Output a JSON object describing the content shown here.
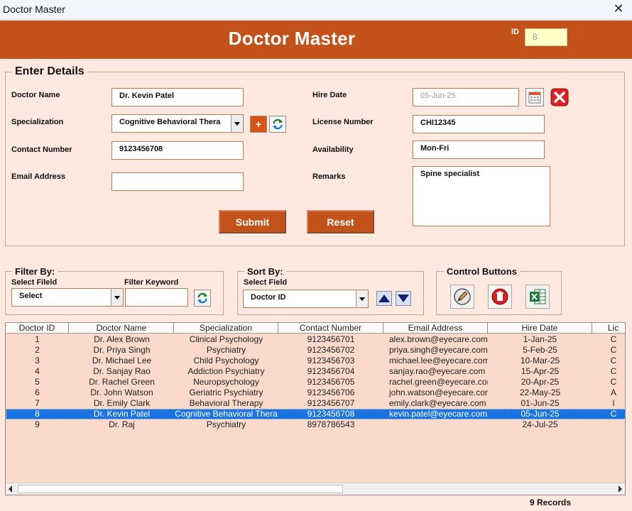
{
  "window": {
    "title": "Doctor Master",
    "close_glyph": "✕"
  },
  "header": {
    "title": "Doctor Master",
    "id_label": "ID",
    "id_value": "8"
  },
  "details": {
    "legend": "Enter Details",
    "doctor_name_label": "Doctor Name",
    "doctor_name_value": "Dr. Kevin Patel",
    "specialization_label": "Specialization",
    "specialization_value": "Cognitive Behavioral Thera",
    "contact_label": "Contact Number",
    "contact_value": "9123456708",
    "email_label": "Email Address",
    "email_value": "",
    "hire_date_label": "Hire Date",
    "hire_date_value": "05-Jun-25",
    "license_label": "License Number",
    "license_value": "CHI12345",
    "availability_label": "Availability",
    "availability_value": "Mon-Fri",
    "remarks_label": "Remarks",
    "remarks_value": "Spine specialist",
    "plus_glyph": "+",
    "submit_label": "Submit",
    "reset_label": "Reset"
  },
  "filter": {
    "legend": "Filter By:",
    "field_label": "Select Fileld",
    "field_value": "Select",
    "keyword_label": "Filter Keyword",
    "keyword_value": ""
  },
  "sort": {
    "legend": "Sort By:",
    "field_label": "Select Field",
    "field_value": "Doctor ID"
  },
  "control": {
    "legend": "Control Buttons"
  },
  "table": {
    "columns": [
      "Doctor ID",
      "Doctor Name",
      "Specialization",
      "Contact Number",
      "Email Address",
      "Hire Date",
      "Lic"
    ],
    "rows": [
      [
        "1",
        "Dr. Alex Brown",
        "Clinical Psychology",
        "9123456701",
        "alex.brown@eyecare.com",
        "1-Jan-25",
        "C"
      ],
      [
        "2",
        "Dr. Priya Singh",
        "Psychiatry",
        "9123456702",
        "priya.singh@eyecare.com",
        "5-Feb-25",
        "C"
      ],
      [
        "3",
        "Dr. Michael Lee",
        "Child Psychology",
        "9123456703",
        "michael.lee@eyecare.com",
        "10-Mar-25",
        "C"
      ],
      [
        "4",
        "Dr. Sanjay Rao",
        "Addiction Psychiatry",
        "9123456704",
        "sanjay.rao@eyecare.com",
        "15-Apr-25",
        "C"
      ],
      [
        "5",
        "Dr. Rachel Green",
        "Neuropsychology",
        "9123456705",
        "rachel.green@eyecare.com",
        "20-Apr-25",
        "C"
      ],
      [
        "6",
        "Dr. John Watson",
        "Geriatric Psychiatry",
        "9123456706",
        "john.watson@eyecare.com",
        "22-May-25",
        "A"
      ],
      [
        "7",
        "Dr. Emily Clark",
        "Behavioral Therapy",
        "9123456707",
        "emily.clark@eyecare.com",
        "01-Jun-25",
        "I"
      ],
      [
        "8",
        "Dr. Kevin Patel",
        "Cognitive Behavioral Thera",
        "9123456708",
        "kevin.patel@eyecare.com",
        "05-Jun-25",
        "C"
      ],
      [
        "9",
        "Dr. Raj",
        "Psychiatry",
        "8978786543",
        "",
        "24-Jul-25",
        ""
      ]
    ],
    "selected_index": 7
  },
  "footer": {
    "record_count": "9 Records"
  },
  "colors": {
    "accent": "#c2521a",
    "background": "#fde9e0",
    "list_bg": "#fbdacb",
    "selection": "#1a73e0"
  },
  "icons": [
    "calendar-icon",
    "clear-date-icon",
    "add-icon",
    "refresh-icon",
    "sort-asc-icon",
    "sort-desc-icon",
    "edit-icon",
    "delete-icon",
    "excel-export-icon"
  ]
}
